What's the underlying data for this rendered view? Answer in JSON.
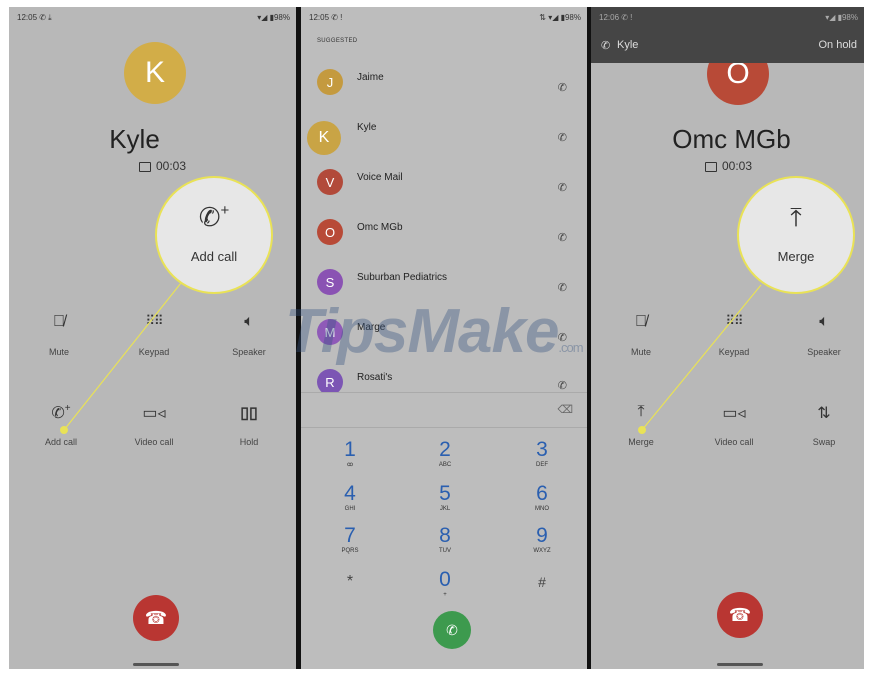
{
  "colors": {
    "highlight": "#e9e256",
    "end_call": "#b93632",
    "answer": "#3d9a4e",
    "keypad_digits": "#2a5fb0"
  },
  "watermark": {
    "main": "TipsMake",
    "suffix": ".com"
  },
  "panel1": {
    "status_time": "12:05 ✆ ⤓",
    "status_right": "▾◢ ▮98%",
    "avatar_letter": "K",
    "avatar_color": "#d2ad48",
    "name": "Kyle",
    "timer": "00:03",
    "callout": {
      "icon": "add-call-icon",
      "label": "Add call"
    },
    "controls": [
      {
        "icon": "mute-icon",
        "label": "Mute"
      },
      {
        "icon": "keypad-icon",
        "label": "Keypad"
      },
      {
        "icon": "speaker-icon",
        "label": "Speaker"
      },
      {
        "icon": "add-call-icon",
        "label": "Add call"
      },
      {
        "icon": "video-call-icon",
        "label": "Video call"
      },
      {
        "icon": "hold-icon",
        "label": "Hold"
      }
    ]
  },
  "panel2": {
    "status_time": "12:05 ✆ !",
    "status_right": "⇅ ▾◢ ▮98%",
    "section_label": "SUGGESTED",
    "contacts": [
      {
        "letter": "J",
        "name": "Jaime",
        "color": "#c49a3f"
      },
      {
        "letter": "K",
        "name": "Kyle",
        "color": "#c9a445"
      },
      {
        "letter": "V",
        "name": "Voice Mail",
        "color": "#b24a3a"
      },
      {
        "letter": "O",
        "name": "Omc MGb",
        "color": "#b84a37"
      },
      {
        "letter": "S",
        "name": "Suburban Pediatrics",
        "color": "#8a52b3"
      },
      {
        "letter": "M",
        "name": "Marge",
        "color": "#8f5ab8"
      },
      {
        "letter": "R",
        "name": "Rosati's",
        "color": "#7c55b4"
      }
    ],
    "keys": [
      {
        "digit": "1",
        "sub": "ꝏ"
      },
      {
        "digit": "2",
        "sub": "ABC"
      },
      {
        "digit": "3",
        "sub": "DEF"
      },
      {
        "digit": "4",
        "sub": "GHI"
      },
      {
        "digit": "5",
        "sub": "JKL"
      },
      {
        "digit": "6",
        "sub": "MNO"
      },
      {
        "digit": "7",
        "sub": "PQRS"
      },
      {
        "digit": "8",
        "sub": "TUV"
      },
      {
        "digit": "9",
        "sub": "WXYZ"
      },
      {
        "digit": "*",
        "sub": ""
      },
      {
        "digit": "0",
        "sub": "+"
      },
      {
        "digit": "#",
        "sub": ""
      }
    ]
  },
  "panel3": {
    "status_time": "12:06 ✆ !",
    "status_right": "▾◢ ▮98%",
    "hold_name": "Kyle",
    "hold_status": "On hold",
    "avatar_letter": "O",
    "avatar_color": "#b84a37",
    "name": "Omc MGb",
    "timer": "00:03",
    "callout": {
      "icon": "merge-icon",
      "label": "Merge"
    },
    "controls": [
      {
        "icon": "mute-icon",
        "label": "Mute"
      },
      {
        "icon": "keypad-icon",
        "label": "Keypad"
      },
      {
        "icon": "speaker-icon",
        "label": "Speaker"
      },
      {
        "icon": "merge-icon",
        "label": "Merge"
      },
      {
        "icon": "video-call-icon",
        "label": "Video call"
      },
      {
        "icon": "swap-icon",
        "label": "Swap"
      }
    ]
  }
}
